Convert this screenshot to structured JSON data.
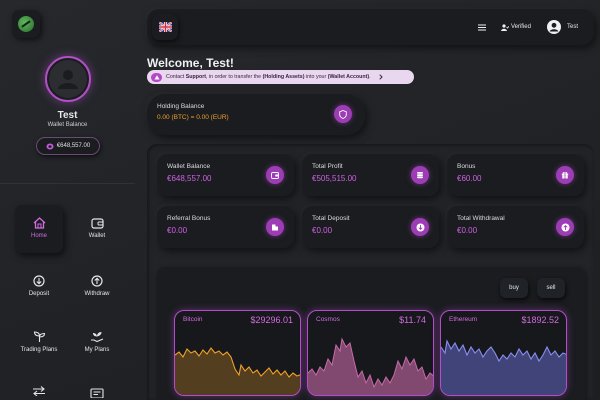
{
  "sidebar": {
    "user_name": "Test",
    "user_subtitle": "Wallet Balance",
    "balance": "€648,557.00",
    "nav": [
      {
        "label": "Home",
        "icon": "home-icon"
      },
      {
        "label": "Wallet",
        "icon": "wallet-icon"
      },
      {
        "label": "Deposit",
        "icon": "deposit-icon"
      },
      {
        "label": "Withdraw",
        "icon": "withdraw-icon"
      },
      {
        "label": "Trading Plans",
        "icon": "trading-plans-icon"
      },
      {
        "label": "My Plans",
        "icon": "my-plans-icon"
      }
    ]
  },
  "topbar": {
    "verified_label": "Verified",
    "user_label": "Test"
  },
  "welcome": "Welcome, Test!",
  "notice": {
    "prefix": "Contact ",
    "support": "Support",
    "middle": ", in order to transfer the ",
    "holding": "(Holding Assets)",
    "into": " into your ",
    "wallet": "(Wallet Account)",
    "end": "."
  },
  "holding": {
    "title": "Holding Balance",
    "value": "0.00 (BTC) = 0.00 (EUR)"
  },
  "stats": [
    {
      "title": "Wallet Balance",
      "value": "€648,557.00"
    },
    {
      "title": "Total Profit",
      "value": "€505,515.00"
    },
    {
      "title": "Bonus",
      "value": "€60.00"
    },
    {
      "title": "Referral Bonus",
      "value": "€0.00"
    },
    {
      "title": "Total Deposit",
      "value": "€0.00"
    },
    {
      "title": "Total Withdrawal",
      "value": "€0.00"
    }
  ],
  "trade": {
    "buy": "buy",
    "sell": "sell"
  },
  "coins": [
    {
      "name": "Bitcoin",
      "price": "$29296.01",
      "color": "#f0a12a"
    },
    {
      "name": "Cosmos",
      "price": "$11.74",
      "color": "#c86aa8"
    },
    {
      "name": "Ethereum",
      "price": "$1892.52",
      "color": "#6b6fd6"
    }
  ],
  "colors": {
    "accent": "#b548c9",
    "accent_text": "#d060e6",
    "background": "#1f2124"
  }
}
